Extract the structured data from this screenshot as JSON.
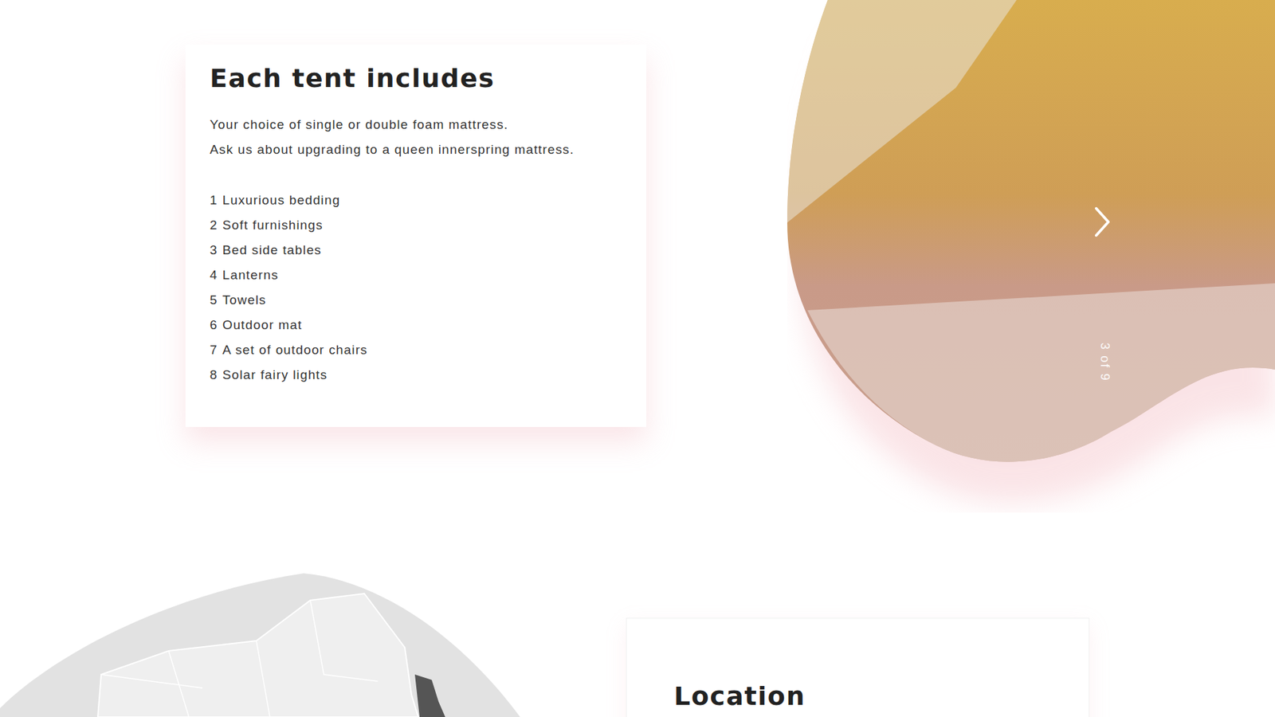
{
  "card": {
    "title": "Each tent includes",
    "intro": [
      "Your choice of single or double foam mattress.",
      "Ask us about upgrading to a queen innerspring mattress."
    ],
    "items": [
      {
        "number": "1",
        "label": "Luxurious bedding"
      },
      {
        "number": "2",
        "label": "Soft furnishings"
      },
      {
        "number": "3",
        "label": "Bed side tables"
      },
      {
        "number": "4",
        "label": "Lanterns"
      },
      {
        "number": "5",
        "label": "Towels"
      },
      {
        "number": "6",
        "label": "Outdoor mat"
      },
      {
        "number": "7",
        "label": "A set of outdoor chairs"
      },
      {
        "number": "8",
        "label": "Solar fairy lights"
      }
    ]
  },
  "gallery": {
    "counter": "3 of 9"
  },
  "location": {
    "title": "Location"
  }
}
